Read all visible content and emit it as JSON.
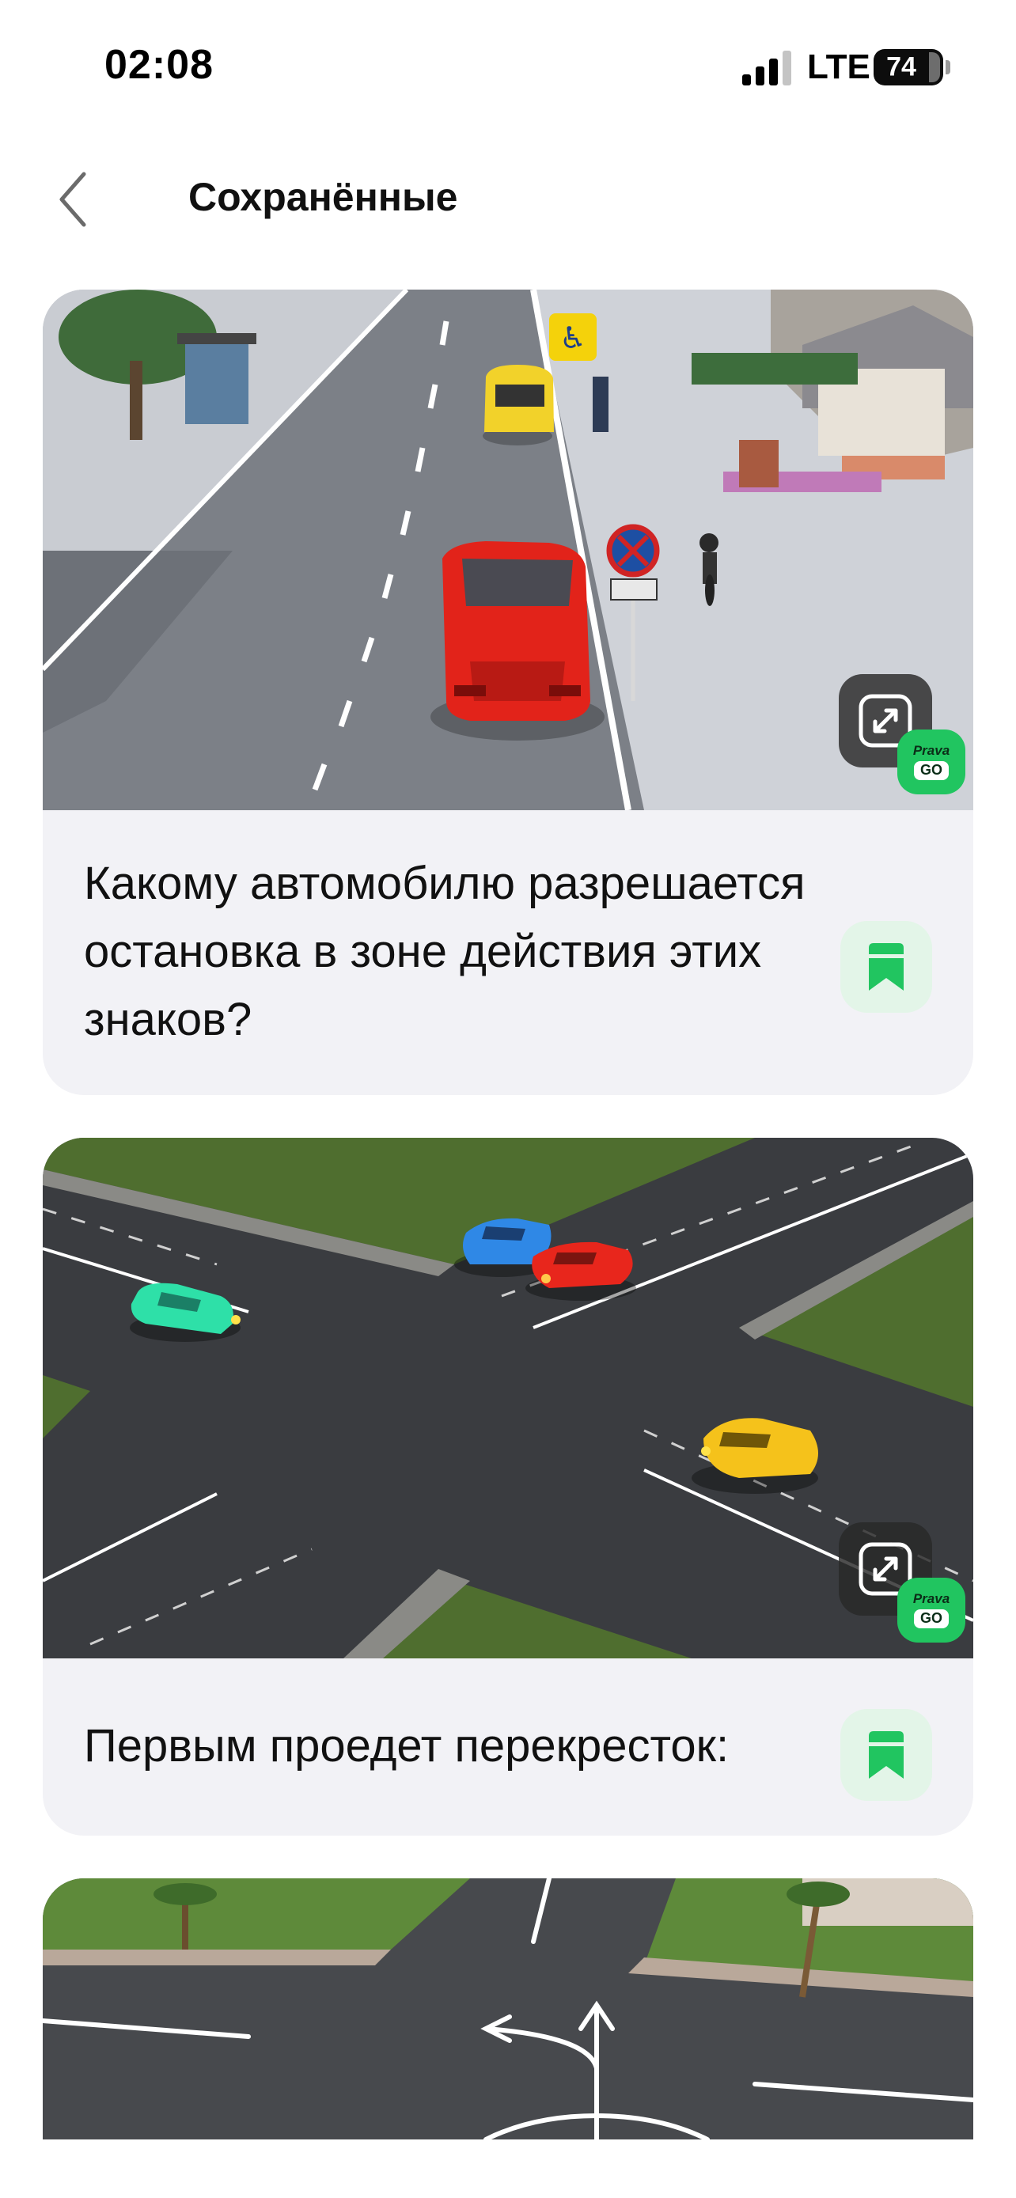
{
  "status_bar": {
    "time": "02:08",
    "network": "LTE",
    "battery": "74"
  },
  "nav": {
    "title": "Сохранённые",
    "back_icon": "chevron-left-icon"
  },
  "cards": [
    {
      "question": "Какому автомобилю разрешается остановка в зоне действия этих знаков?",
      "badge_top": "Prava",
      "badge_bottom": "GO"
    },
    {
      "question": "Первым проедет перекресток:",
      "badge_top": "Prava",
      "badge_bottom": "GO"
    }
  ],
  "colors": {
    "accent": "#21c560",
    "card_bg": "#f2f2f6",
    "bookmark_bg": "#e3f5e8"
  }
}
